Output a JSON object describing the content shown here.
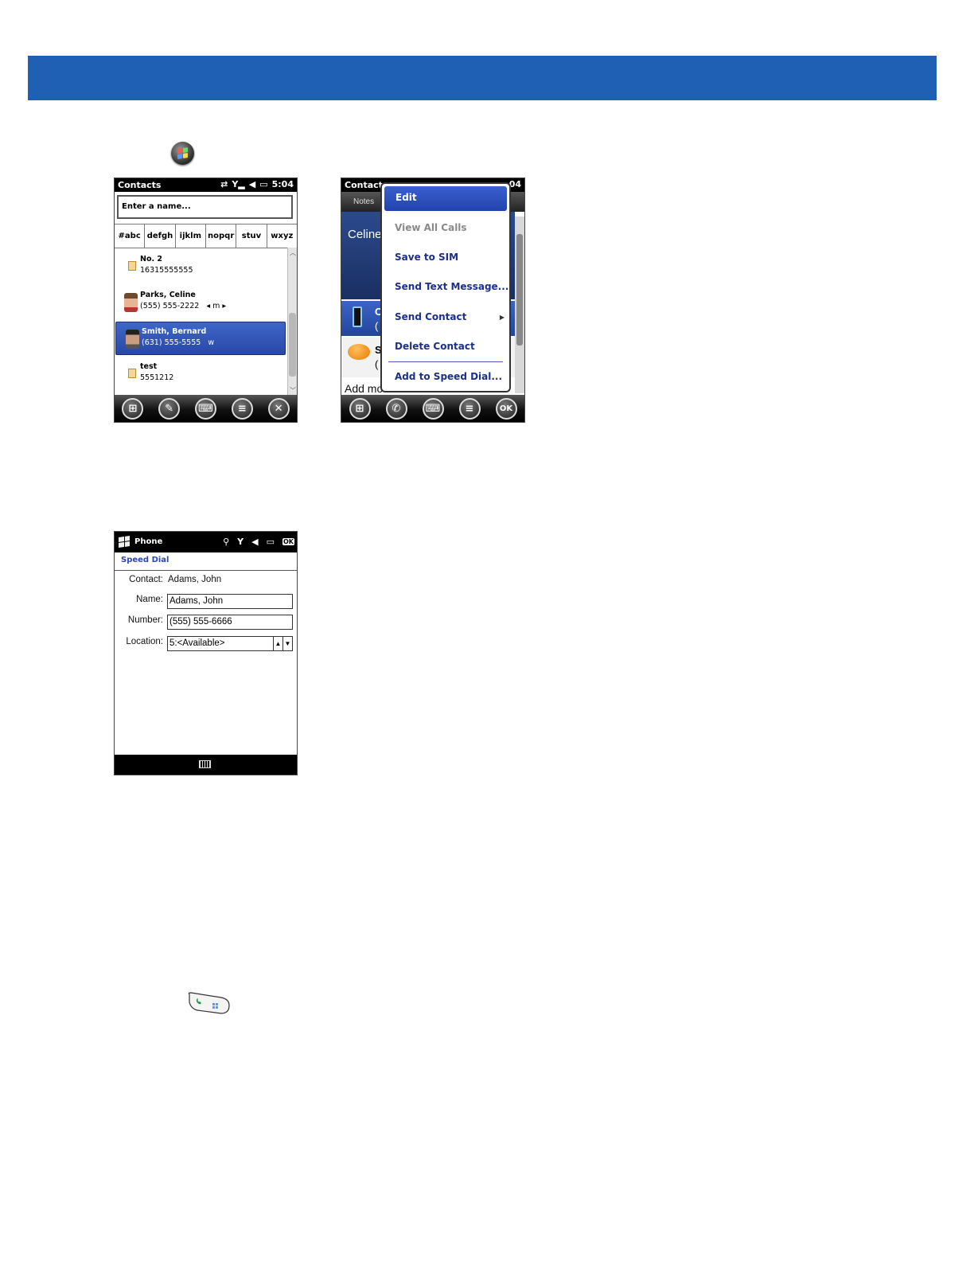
{
  "screen1": {
    "status_title": "Contacts",
    "status_time": "5:04",
    "search_placeholder": "Enter a name...",
    "letter_groups": [
      "#abc",
      "defgh",
      "ijklm",
      "nopqr",
      "stuv",
      "wxyz"
    ],
    "contacts": [
      {
        "name": "No. 2",
        "phone": "16315555555",
        "icon": "contact-card-icon"
      },
      {
        "name": "Parks, Celine",
        "phone": "(555) 555-2222",
        "extra": "◂ m ▸",
        "icon": "photo-icon"
      },
      {
        "name": "Smith, Bernard",
        "phone": "(631) 555-5555",
        "extra": "w",
        "icon": "photo-icon",
        "selected": true
      },
      {
        "name": "test",
        "phone": "5551212",
        "icon": "contact-card-icon"
      }
    ],
    "toolbar": [
      "start-icon",
      "new-contact-icon",
      "keyboard-icon",
      "menu-icon",
      "close-icon"
    ]
  },
  "screen2": {
    "status_title": "Contacts",
    "status_time_fragment": "04",
    "tab_label": "Notes",
    "contact_first_name": "Celine",
    "row1_initial": "C",
    "row1_sub": "(",
    "row2_initial": "S",
    "row2_sub": "(",
    "add_more": "Add mo",
    "menu_items": [
      {
        "label": "Edit",
        "state": "selected"
      },
      {
        "label": "View All Calls",
        "state": "disabled"
      },
      {
        "label": "Save to SIM",
        "state": "normal"
      },
      {
        "label": "Send Text Message...",
        "state": "normal"
      },
      {
        "label": "Send Contact",
        "state": "normal",
        "submenu": true
      },
      {
        "label": "Delete Contact",
        "state": "normal"
      },
      {
        "label": "Add to Speed Dial...",
        "state": "normal"
      }
    ],
    "toolbar_ok": "OK"
  },
  "screen3": {
    "title": "Phone",
    "ok_label": "OK",
    "section_title": "Speed Dial",
    "contact_label": "Contact:",
    "contact_value": "Adams, John",
    "name_label": "Name:",
    "name_value": "Adams, John",
    "number_label": "Number:",
    "number_value": "(555) 555-6666",
    "location_label": "Location:",
    "location_value": "5:<Available>"
  },
  "colors": {
    "banner": "#1f5fb4",
    "selection": "#2848a8",
    "link": "#2e45b8"
  }
}
